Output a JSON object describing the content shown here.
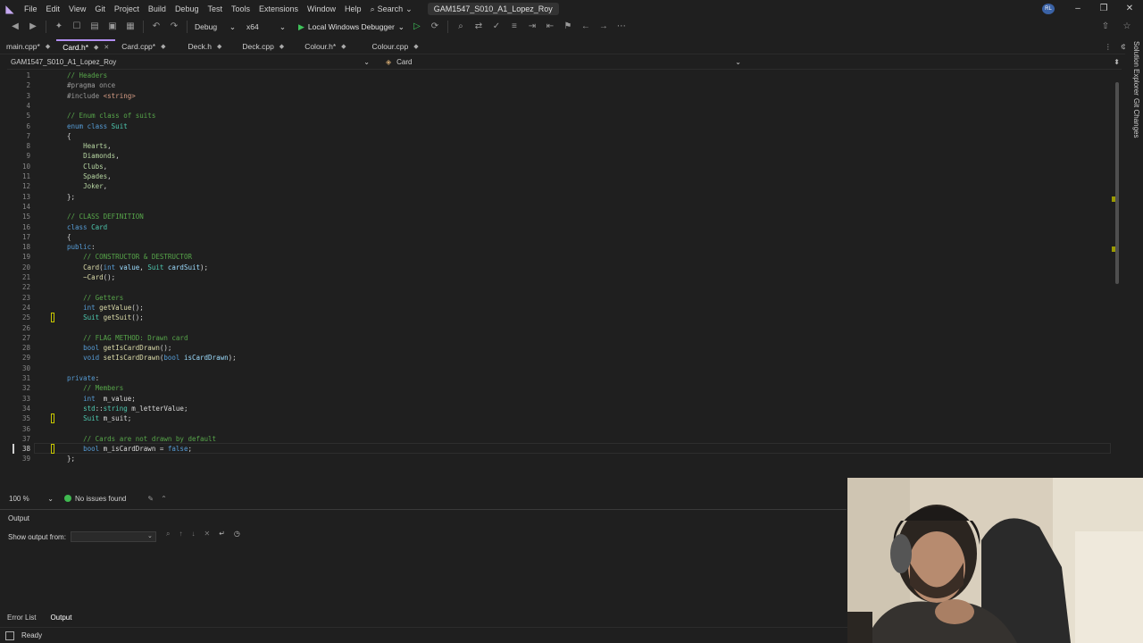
{
  "menubar": {
    "items": [
      "File",
      "Edit",
      "View",
      "Git",
      "Project",
      "Build",
      "Debug",
      "Test",
      "Tools",
      "Extensions",
      "Window",
      "Help"
    ],
    "search_label": "Search",
    "solution_name": "GAM1547_S010_A1_Lopez_Roy",
    "avatar_initials": "RL"
  },
  "toolbar": {
    "configuration": "Debug",
    "platform": "x64",
    "run_label": "Local Windows Debugger"
  },
  "tabs": [
    {
      "label": "main.cpp*",
      "active": false
    },
    {
      "label": "Card.h*",
      "active": true
    },
    {
      "label": "Card.cpp*",
      "active": false
    },
    {
      "label": "Deck.h",
      "active": false
    },
    {
      "label": "Deck.cpp",
      "active": false
    },
    {
      "label": "Colour.h*",
      "active": false
    },
    {
      "label": "Colour.cpp",
      "active": false
    }
  ],
  "navbar": {
    "project": "GAM1547_S010_A1_Lopez_Roy",
    "scope": "Card"
  },
  "editor": {
    "current_line": 38,
    "change_markers": [
      25,
      35,
      38
    ],
    "lines": [
      {
        "n": 1,
        "tokens": [
          [
            "comment",
            "// Headers"
          ]
        ]
      },
      {
        "n": 2,
        "tokens": [
          [
            "pp",
            "#pragma once"
          ]
        ]
      },
      {
        "n": 3,
        "tokens": [
          [
            "pp",
            "#include "
          ],
          [
            "str",
            "<string>"
          ]
        ]
      },
      {
        "n": 4,
        "tokens": []
      },
      {
        "n": 5,
        "tokens": [
          [
            "comment",
            "// Enum class of suits"
          ]
        ]
      },
      {
        "n": 6,
        "tokens": [
          [
            "kw",
            "enum class "
          ],
          [
            "type",
            "Suit"
          ]
        ]
      },
      {
        "n": 7,
        "tokens": [
          [
            "plain",
            "{"
          ]
        ]
      },
      {
        "n": 8,
        "tokens": [
          [
            "plain",
            "    "
          ],
          [
            "enum",
            "Hearts"
          ],
          [
            "plain",
            ","
          ]
        ]
      },
      {
        "n": 9,
        "tokens": [
          [
            "plain",
            "    "
          ],
          [
            "enum",
            "Diamonds"
          ],
          [
            "plain",
            ","
          ]
        ]
      },
      {
        "n": 10,
        "tokens": [
          [
            "plain",
            "    "
          ],
          [
            "enum",
            "Clubs"
          ],
          [
            "plain",
            ","
          ]
        ]
      },
      {
        "n": 11,
        "tokens": [
          [
            "plain",
            "    "
          ],
          [
            "enum",
            "Spades"
          ],
          [
            "plain",
            ","
          ]
        ]
      },
      {
        "n": 12,
        "tokens": [
          [
            "plain",
            "    "
          ],
          [
            "enum",
            "Joker"
          ],
          [
            "plain",
            ","
          ]
        ]
      },
      {
        "n": 13,
        "tokens": [
          [
            "plain",
            "};"
          ]
        ]
      },
      {
        "n": 14,
        "tokens": []
      },
      {
        "n": 15,
        "tokens": [
          [
            "comment",
            "// CLASS DEFINITION"
          ]
        ]
      },
      {
        "n": 16,
        "tokens": [
          [
            "kw",
            "class "
          ],
          [
            "type",
            "Card"
          ]
        ]
      },
      {
        "n": 17,
        "tokens": [
          [
            "plain",
            "{"
          ]
        ]
      },
      {
        "n": 18,
        "tokens": [
          [
            "kw",
            "public"
          ],
          [
            "plain",
            ":"
          ]
        ]
      },
      {
        "n": 19,
        "tokens": [
          [
            "plain",
            "    "
          ],
          [
            "comment",
            "// CONSTRUCTOR & DESTRUCTOR"
          ]
        ]
      },
      {
        "n": 20,
        "tokens": [
          [
            "plain",
            "    "
          ],
          [
            "func",
            "Card"
          ],
          [
            "plain",
            "("
          ],
          [
            "kw",
            "int "
          ],
          [
            "param",
            "value"
          ],
          [
            "plain",
            ", "
          ],
          [
            "type",
            "Suit "
          ],
          [
            "param",
            "cardSuit"
          ],
          [
            "plain",
            ");"
          ]
        ]
      },
      {
        "n": 21,
        "tokens": [
          [
            "plain",
            "    "
          ],
          [
            "func",
            "~Card"
          ],
          [
            "plain",
            "();"
          ]
        ]
      },
      {
        "n": 22,
        "tokens": []
      },
      {
        "n": 23,
        "tokens": [
          [
            "plain",
            "    "
          ],
          [
            "comment",
            "// Getters"
          ]
        ]
      },
      {
        "n": 24,
        "tokens": [
          [
            "plain",
            "    "
          ],
          [
            "kw",
            "int "
          ],
          [
            "func",
            "getValue"
          ],
          [
            "plain",
            "();"
          ]
        ]
      },
      {
        "n": 25,
        "tokens": [
          [
            "plain",
            "    "
          ],
          [
            "type",
            "Suit "
          ],
          [
            "func",
            "getSuit"
          ],
          [
            "plain",
            "();"
          ]
        ]
      },
      {
        "n": 26,
        "tokens": []
      },
      {
        "n": 27,
        "tokens": [
          [
            "plain",
            "    "
          ],
          [
            "comment",
            "// FLAG METHOD: Drawn card"
          ]
        ]
      },
      {
        "n": 28,
        "tokens": [
          [
            "plain",
            "    "
          ],
          [
            "kw",
            "bool "
          ],
          [
            "func",
            "getIsCardDrawn"
          ],
          [
            "plain",
            "();"
          ]
        ]
      },
      {
        "n": 29,
        "tokens": [
          [
            "plain",
            "    "
          ],
          [
            "kw",
            "void "
          ],
          [
            "func",
            "setIsCardDrawn"
          ],
          [
            "plain",
            "("
          ],
          [
            "kw",
            "bool "
          ],
          [
            "param",
            "isCardDrawn"
          ],
          [
            "plain",
            ");"
          ]
        ]
      },
      {
        "n": 30,
        "tokens": []
      },
      {
        "n": 31,
        "tokens": [
          [
            "kw",
            "private"
          ],
          [
            "plain",
            ":"
          ]
        ]
      },
      {
        "n": 32,
        "tokens": [
          [
            "plain",
            "    "
          ],
          [
            "comment",
            "// Members"
          ]
        ]
      },
      {
        "n": 33,
        "tokens": [
          [
            "plain",
            "    "
          ],
          [
            "kw",
            "int  "
          ],
          [
            "mvar",
            "m_value"
          ],
          [
            "plain",
            ";"
          ]
        ]
      },
      {
        "n": 34,
        "tokens": [
          [
            "plain",
            "    "
          ],
          [
            "type",
            "std"
          ],
          [
            "plain",
            "::"
          ],
          [
            "type",
            "string "
          ],
          [
            "mvar",
            "m_letterValue"
          ],
          [
            "plain",
            ";"
          ]
        ]
      },
      {
        "n": 35,
        "tokens": [
          [
            "plain",
            "    "
          ],
          [
            "type",
            "Suit "
          ],
          [
            "mvar",
            "m_suit"
          ],
          [
            "plain",
            ";"
          ]
        ]
      },
      {
        "n": 36,
        "tokens": []
      },
      {
        "n": 37,
        "tokens": [
          [
            "plain",
            "    "
          ],
          [
            "comment",
            "// Cards are not drawn by default"
          ]
        ]
      },
      {
        "n": 38,
        "tokens": [
          [
            "plain",
            "    "
          ],
          [
            "kw",
            "bool "
          ],
          [
            "mvar",
            "m_isCardDrawn"
          ],
          [
            "plain",
            " = "
          ],
          [
            "kw",
            "false"
          ],
          [
            "plain",
            ";"
          ]
        ]
      },
      {
        "n": 39,
        "tokens": [
          [
            "plain",
            "};"
          ]
        ]
      }
    ]
  },
  "editor_status": {
    "zoom": "100 %",
    "issues": "No issues found"
  },
  "output": {
    "title": "Output",
    "show_from_label": "Show output from:",
    "show_from_value": ""
  },
  "bottom_tabs": [
    "Error List",
    "Output"
  ],
  "side_tabs": [
    "Solution Explorer",
    "Git Changes"
  ],
  "statusbar": {
    "text": "Ready"
  },
  "colors": {
    "accent": "#b28ef2",
    "comment": "#57a64a",
    "keyword": "#569cd6",
    "type": "#4ec9b0",
    "function": "#dcdcaa"
  }
}
